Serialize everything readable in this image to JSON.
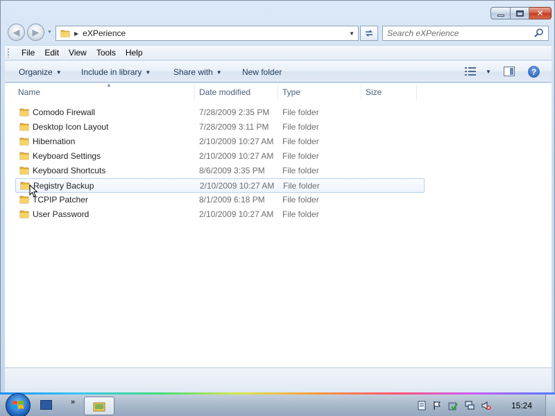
{
  "window": {
    "caption_buttons": [
      "minimize",
      "maximize",
      "close"
    ]
  },
  "address_bar": {
    "crumb": "eXPerience",
    "icon": "folder-icon"
  },
  "search": {
    "placeholder": "Search eXPerience"
  },
  "menu": {
    "items": [
      {
        "label": "File"
      },
      {
        "label": "Edit"
      },
      {
        "label": "View"
      },
      {
        "label": "Tools"
      },
      {
        "label": "Help"
      }
    ]
  },
  "commands": {
    "organize": "Organize",
    "include_in_library": "Include in library",
    "share_with": "Share with",
    "new_folder": "New folder",
    "help": "?"
  },
  "columns": {
    "name": "Name",
    "date_modified": "Date modified",
    "type": "Type",
    "size": "Size"
  },
  "files": [
    {
      "name": "Comodo Firewall",
      "date": "7/28/2009 2:35 PM",
      "type": "File folder"
    },
    {
      "name": "Desktop Icon Layout",
      "date": "7/28/2009 3:11 PM",
      "type": "File folder"
    },
    {
      "name": "Hibernation",
      "date": "2/10/2009 10:27 AM",
      "type": "File folder"
    },
    {
      "name": "Keyboard Settings",
      "date": "2/10/2009 10:27 AM",
      "type": "File folder"
    },
    {
      "name": "Keyboard Shortcuts",
      "date": "8/6/2009 3:35 PM",
      "type": "File folder"
    },
    {
      "name": "Registry Backup",
      "date": "2/10/2009 10:27 AM",
      "type": "File folder",
      "hovered": true
    },
    {
      "name": "TCPIP Patcher",
      "date": "8/1/2009 6:18 PM",
      "type": "File folder"
    },
    {
      "name": "User Password",
      "date": "2/10/2009 10:27 AM",
      "type": "File folder"
    }
  ],
  "taskbar": {
    "clock": "15:24",
    "quick_launch_more": "»",
    "tray_icons": [
      "action-center-flag-icon",
      "security-check-icon",
      "network-icon",
      "volume-muted-icon"
    ]
  },
  "colors": {
    "folder_yellow": "#f3c94c",
    "accent_blue": "#1e395b",
    "hover_border": "#b9d1f0"
  }
}
